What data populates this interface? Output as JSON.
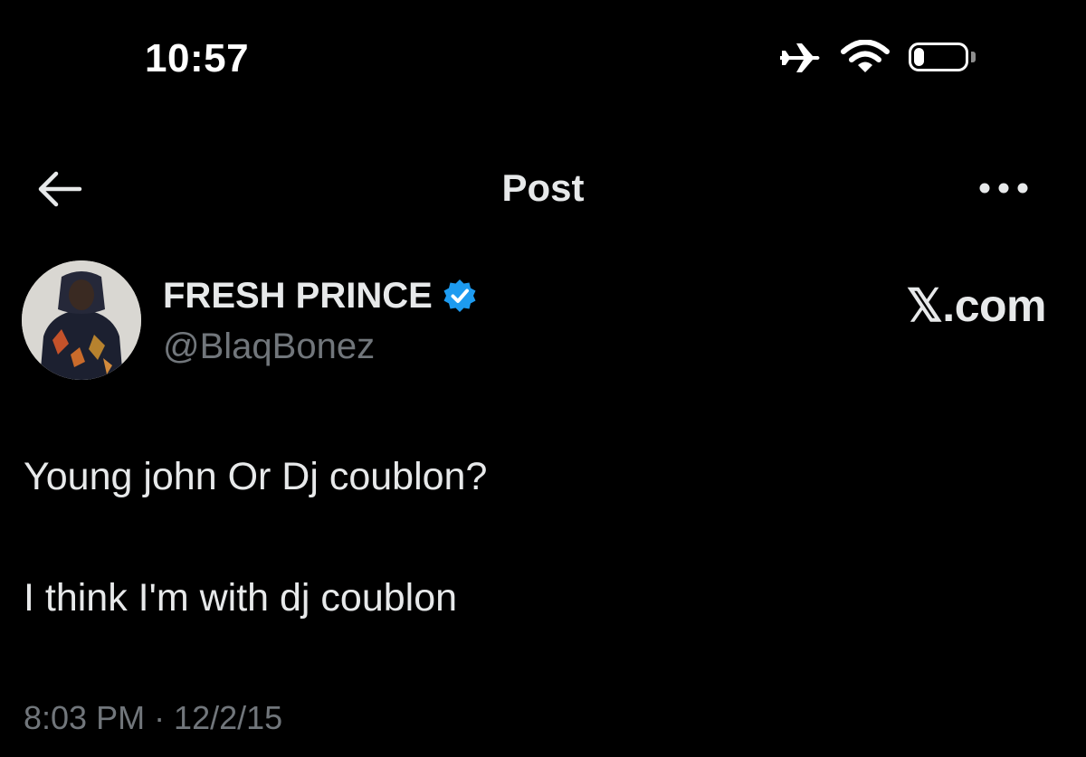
{
  "status_bar": {
    "time": "10:57",
    "icons": [
      "airplane-icon",
      "wifi-icon",
      "battery-icon"
    ],
    "battery_level": 0.2
  },
  "header": {
    "title": "Post",
    "back_icon": "back-arrow-icon",
    "more_icon": "more-icon"
  },
  "author": {
    "name": "FRESH PRINCE",
    "handle": "@BlaqBonez",
    "verified": true,
    "verified_color": "#1d9bf0"
  },
  "brand": "𝕏.com",
  "post": {
    "line1": "Young john Or Dj coublon?",
    "line2": "I think I'm with dj coublon",
    "meta": "8:03 PM · 12/2/15"
  },
  "colors": {
    "background": "#000000",
    "text": "#e7e9ea",
    "secondary": "#71767b"
  }
}
